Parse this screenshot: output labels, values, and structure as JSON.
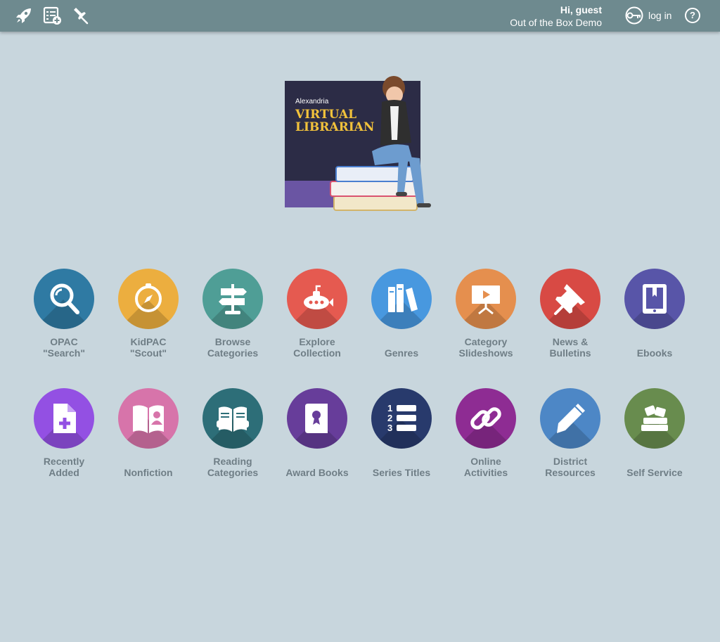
{
  "topbar": {
    "icons": [
      "rocket-icon",
      "list-add-icon",
      "pin-icon"
    ],
    "greeting": "Hi, guest",
    "site_name": "Out of the Box Demo",
    "login_label": "log in",
    "help_label": "?",
    "color": "#6e8a8f"
  },
  "banner": {
    "brand": "Alexandria",
    "title_line1": "VIRTUAL",
    "title_line2": "LIBRARIAN"
  },
  "tiles": [
    {
      "label": "OPAC\n\"Search\"",
      "icon": "magnifier-icon",
      "color": "#2f7aa3"
    },
    {
      "label": "KidPAC\n\"Scout\"",
      "icon": "compass-icon",
      "color": "#ecae3f"
    },
    {
      "label": "Browse\nCategories",
      "icon": "signpost-icon",
      "color": "#4f9e96"
    },
    {
      "label": "Explore\nCollection",
      "icon": "submarine-icon",
      "color": "#e55a50"
    },
    {
      "label": "Genres",
      "icon": "books-icon",
      "color": "#4898df"
    },
    {
      "label": "Category\nSlideshows",
      "icon": "projector-icon",
      "color": "#e58f4e"
    },
    {
      "label": "News &\nBulletins",
      "icon": "pushpin-icon",
      "color": "#d84a44"
    },
    {
      "label": "Ebooks",
      "icon": "ebook-icon",
      "color": "#5855a8"
    },
    {
      "label": "Recently\nAdded",
      "icon": "new-document-icon",
      "color": "#9350e3"
    },
    {
      "label": "Nonfiction",
      "icon": "open-book-icon",
      "color": "#d774aa"
    },
    {
      "label": "Reading\nCategories",
      "icon": "reading-icon",
      "color": "#2d6e78"
    },
    {
      "label": "Award Books",
      "icon": "award-book-icon",
      "color": "#673d9a"
    },
    {
      "label": "Series Titles",
      "icon": "numbered-list-icon",
      "color": "#283a6c"
    },
    {
      "label": "Online\nActivities",
      "icon": "link-icon",
      "color": "#8e2c93"
    },
    {
      "label": "District\nResources",
      "icon": "pencil-icon",
      "color": "#4d87c6"
    },
    {
      "label": "Self Service",
      "icon": "book-stack-icon",
      "color": "#688c4e"
    }
  ]
}
